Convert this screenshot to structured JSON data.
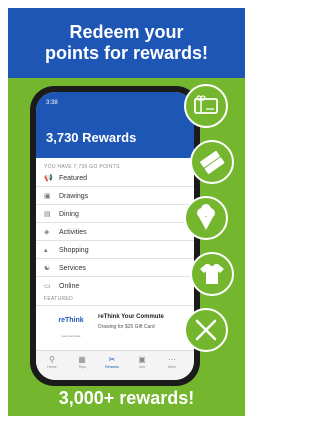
{
  "banner": {
    "line1": "Redeem your",
    "line2": "points for rewards!"
  },
  "phone": {
    "status_time": "3:38",
    "points_title": "3,730 Rewards",
    "section_label": "YOU HAVE 7,730 GO POINTS",
    "categories": [
      {
        "label": "Featured",
        "icon": "megaphone-icon"
      },
      {
        "label": "Drawings",
        "icon": "ticket-icon"
      },
      {
        "label": "Dining",
        "icon": "dining-icon"
      },
      {
        "label": "Activities",
        "icon": "tag-icon"
      },
      {
        "label": "Shopping",
        "icon": "cart-icon"
      },
      {
        "label": "Services",
        "icon": "services-icon"
      },
      {
        "label": "Online",
        "icon": "monitor-icon"
      }
    ],
    "featured_label": "FEATURED",
    "featured_logo": "reThink",
    "featured_logo_sub": "your commute",
    "featured_title": "reThink Your Commute",
    "featured_desc": "Drawing for $25 Gift Card",
    "tabs": [
      {
        "label": "Home",
        "icon": "search-icon"
      },
      {
        "label": "Trips",
        "icon": "calendar-icon"
      },
      {
        "label": "Rewards",
        "icon": "scissors-icon"
      },
      {
        "label": "Info",
        "icon": "camera-icon"
      },
      {
        "label": "More",
        "icon": "more-icon"
      }
    ]
  },
  "reward_icons": [
    "gift-card-icon",
    "tickets-icon",
    "ice-cream-icon",
    "shirt-icon",
    "fork-knife-icon"
  ],
  "footer": "3,000+ rewards!",
  "colors": {
    "green": "#74b72e",
    "blue": "#1e56b5"
  }
}
